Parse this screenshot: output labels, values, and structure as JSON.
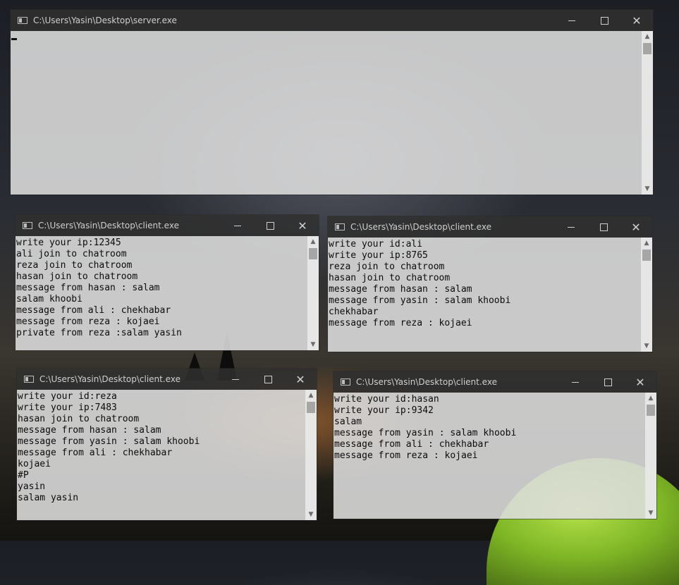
{
  "server_window": {
    "title": "C:\\Users\\Yasin\\Desktop\\server.exe",
    "lines": []
  },
  "client_window_1": {
    "title": "C:\\Users\\Yasin\\Desktop\\client.exe",
    "lines": [
      "write your ip:12345",
      "ali join to chatroom",
      "reza join to chatroom",
      "hasan join to chatroom",
      "message from hasan : salam",
      "salam khoobi",
      "message from ali : chekhabar",
      "message from reza : kojaei",
      "private from reza :salam yasin"
    ]
  },
  "client_window_2": {
    "title": "C:\\Users\\Yasin\\Desktop\\client.exe",
    "lines": [
      "write your id:ali",
      "write your ip:8765",
      "reza join to chatroom",
      "hasan join to chatroom",
      "message from hasan : salam",
      "message from yasin : salam khoobi",
      "chekhabar",
      "message from reza : kojaei"
    ]
  },
  "client_window_3": {
    "title": "C:\\Users\\Yasin\\Desktop\\client.exe",
    "lines": [
      "write your id:reza",
      "write your ip:7483",
      "hasan join to chatroom",
      "message from hasan : salam",
      "message from yasin : salam khoobi",
      "message from ali : chekhabar",
      "kojaei",
      "#P",
      "yasin",
      "salam yasin"
    ]
  },
  "client_window_4": {
    "title": "C:\\Users\\Yasin\\Desktop\\client.exe",
    "lines": [
      "write your id:hasan",
      "write your ip:9342",
      "salam",
      "message from yasin : salam khoobi",
      "message from ali : chekhabar",
      "message from reza : kojaei"
    ]
  },
  "icons": {
    "window_icon": "console-app-icon",
    "minimize": "minimize-icon",
    "maximize": "maximize-icon",
    "close": "close-icon",
    "scroll_up": "chevron-up-icon",
    "scroll_down": "chevron-down-icon"
  },
  "colors": {
    "titlebar": "#303030",
    "console_bg": "#dedede",
    "console_text": "#0c0c0c"
  }
}
